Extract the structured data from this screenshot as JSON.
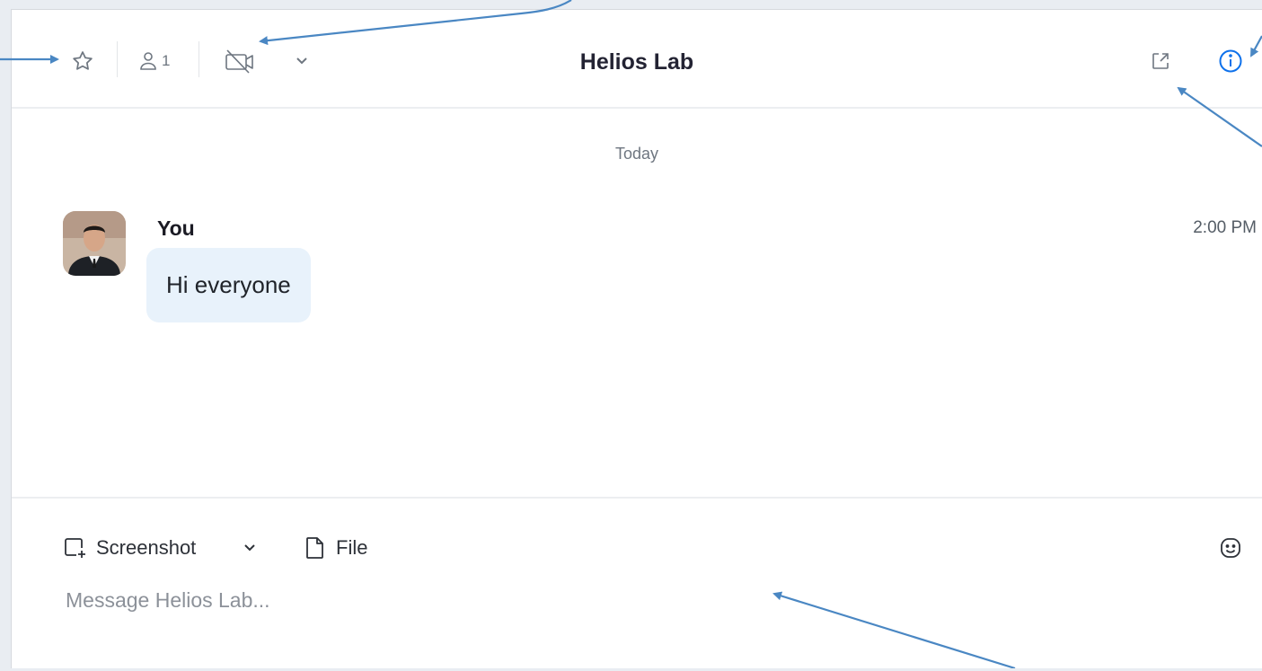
{
  "header": {
    "title": "Helios Lab",
    "member_count": "1"
  },
  "chat": {
    "date_divider": "Today",
    "messages": [
      {
        "sender": "You",
        "time": "2:00 PM",
        "text": "Hi everyone"
      }
    ]
  },
  "composer": {
    "screenshot_label": "Screenshot",
    "file_label": "File",
    "placeholder": "Message Helios Lab..."
  },
  "colors": {
    "info_icon": "#0e71eb",
    "bubble": "#e8f2fb",
    "annotation_arrow": "#4a87c3"
  },
  "icons": [
    "star-icon",
    "person-icon",
    "video-off-icon",
    "chevron-down-icon",
    "pop-out-icon",
    "info-icon",
    "screenshot-icon",
    "file-icon",
    "emoji-icon"
  ]
}
